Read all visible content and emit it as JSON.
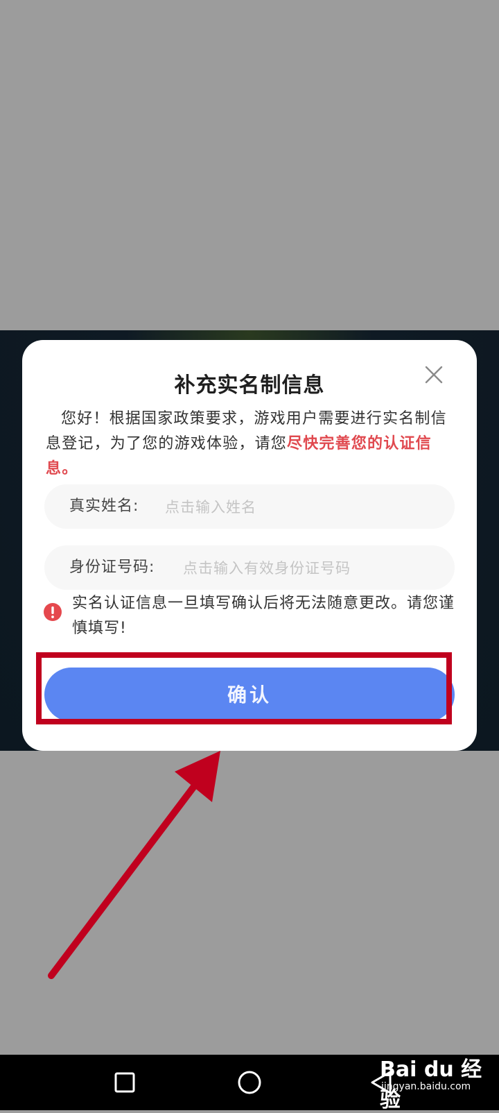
{
  "dialog": {
    "title": "补充实名制信息",
    "intro_normal": "您好！根据国家政策要求，游戏用户需要进行实名制信息登记，为了您的游戏体验，请您",
    "intro_highlight": "尽快完善您的认证信息。",
    "name_field": {
      "label": "真实姓名:",
      "placeholder": "点击输入姓名"
    },
    "id_field": {
      "label": "身份证号码:",
      "placeholder": "点击输入有效身份证号码"
    },
    "warning": "实名认证信息一旦填写确认后将无法随意更改。请您谨慎填写!",
    "confirm_label": "确认"
  },
  "watermark": {
    "brand": "Bai du 经验",
    "url": "jingyan.baidu.com"
  },
  "icons": {
    "close": "close-icon",
    "warning": "exclamation-icon",
    "nav_recent": "square-icon",
    "nav_home": "circle-icon",
    "nav_back": "triangle-back-icon"
  },
  "colors": {
    "accent_button": "#5b86f2",
    "highlight_text": "#e0494f",
    "warning_icon": "#e5484d",
    "annotation_red": "#c0001e"
  }
}
